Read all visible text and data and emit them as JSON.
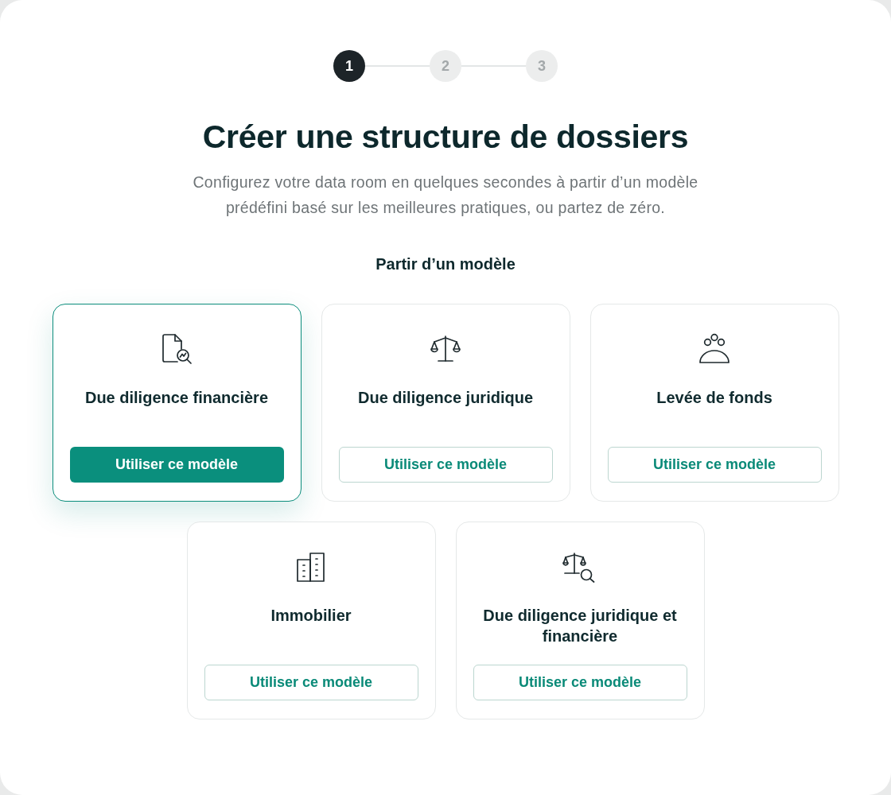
{
  "stepper": {
    "steps": [
      {
        "label": "1",
        "selected": true
      },
      {
        "label": "2",
        "selected": false
      },
      {
        "label": "3",
        "selected": false
      }
    ]
  },
  "header": {
    "title": "Créer une structure de dossiers",
    "subtitle": "Configurez votre data room en quelques secondes à partir d’un modèle prédéfini basé sur les meilleures pratiques, ou partez de zéro."
  },
  "section": {
    "heading": "Partir d’un modèle",
    "templates": [
      {
        "kind": "document-search",
        "title": "Due diligence financière",
        "button": "Utiliser ce modèle",
        "selected": true
      },
      {
        "kind": "scale",
        "title": "Due diligence juridique",
        "button": "Utiliser ce modèle",
        "selected": false
      },
      {
        "kind": "people",
        "title": "Levée de fonds",
        "button": "Utiliser ce modèle",
        "selected": false
      },
      {
        "kind": "buildings",
        "title": "Immobilier",
        "button": "Utiliser ce modèle",
        "selected": false
      },
      {
        "kind": "scale-search",
        "title": "Due diligence juridique et financière",
        "button": "Utiliser ce modèle",
        "selected": false
      }
    ]
  }
}
